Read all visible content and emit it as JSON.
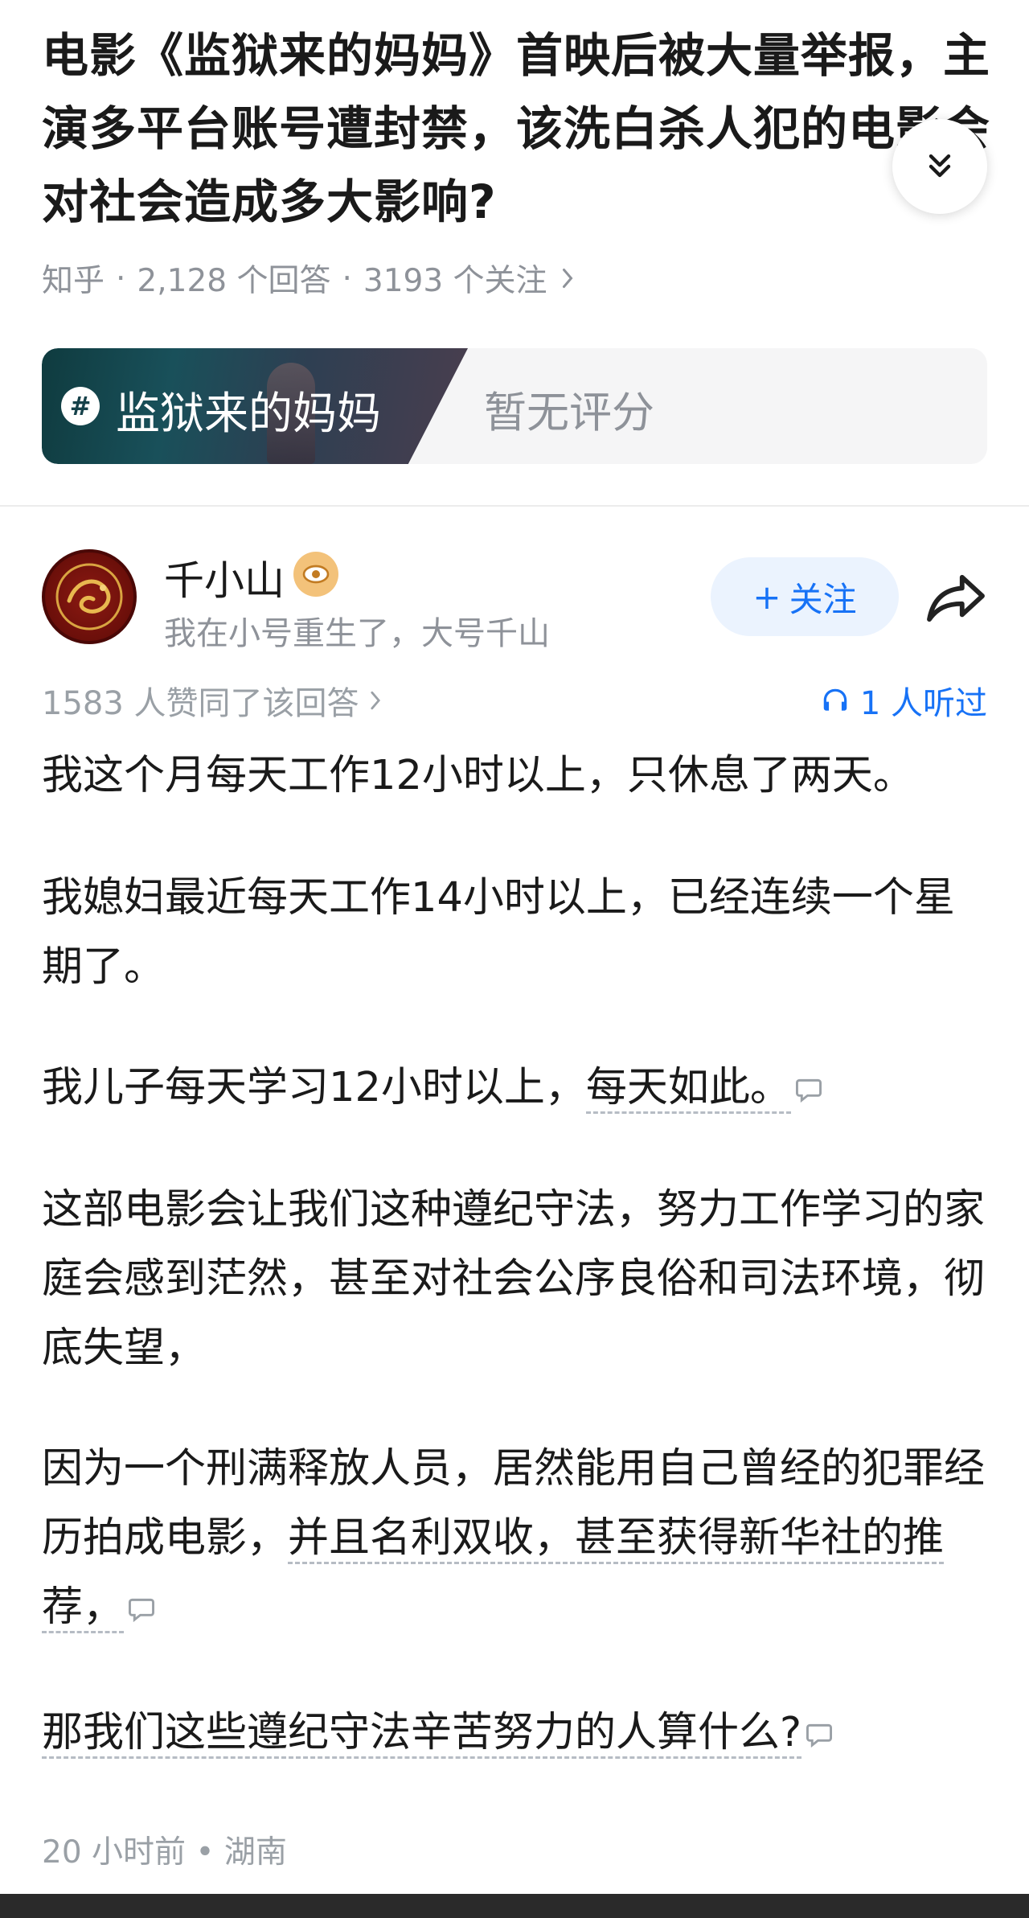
{
  "question": {
    "title": "电影《监狱来的妈妈》首映后被大量举报，主演多平台账号遭封禁，该洗白杀人犯的电影会对社会造成多大影响?",
    "source": "知乎",
    "answer_count": "2,128 个回答",
    "follow_count": "3193 个关注",
    "separator": "·"
  },
  "movie_card": {
    "name": "监狱来的妈妈",
    "rating": "暂无评分",
    "hash_symbol": "#"
  },
  "author": {
    "name": "千小山",
    "bio": "我在小号重生了，大号千山",
    "follow_label": "关注",
    "follow_plus": "+"
  },
  "answer_meta": {
    "likes": "1583 人赞同了该回答",
    "listened": "1 人听过"
  },
  "paragraphs": {
    "p1": "我这个月每天工作12小时以上，只休息了两天。",
    "p2": "我媳妇最近每天工作14小时以上，已经连续一个星期了。",
    "p3_plain": "我儿子每天学习12小时以上，",
    "p3_hl": "每天如此。",
    "p4": "这部电影会让我们这种遵纪守法，努力工作学习的家庭会感到茫然，甚至对社会公序良俗和司法环境，彻底失望，",
    "p5_plain": "因为一个刑满释放人员，居然能用自己曾经的犯罪经历拍成电影，",
    "p5_hl": "并且名利双收，甚至获得新华社的推荐，",
    "p6_hl": "那我们这些遵纪守法辛苦努力的人算什么?"
  },
  "footer": {
    "time": "20 小时前",
    "location": "湖南",
    "dot": "•"
  },
  "colors": {
    "accent": "#1772f6",
    "follow_bg": "#ebf3fe",
    "muted": "#8e9299"
  },
  "icons": [
    "chevron-double-down-icon",
    "hash-icon",
    "verified-badge-icon",
    "plus-icon",
    "share-icon",
    "chevron-right-icon",
    "headphones-icon",
    "comment-icon"
  ]
}
